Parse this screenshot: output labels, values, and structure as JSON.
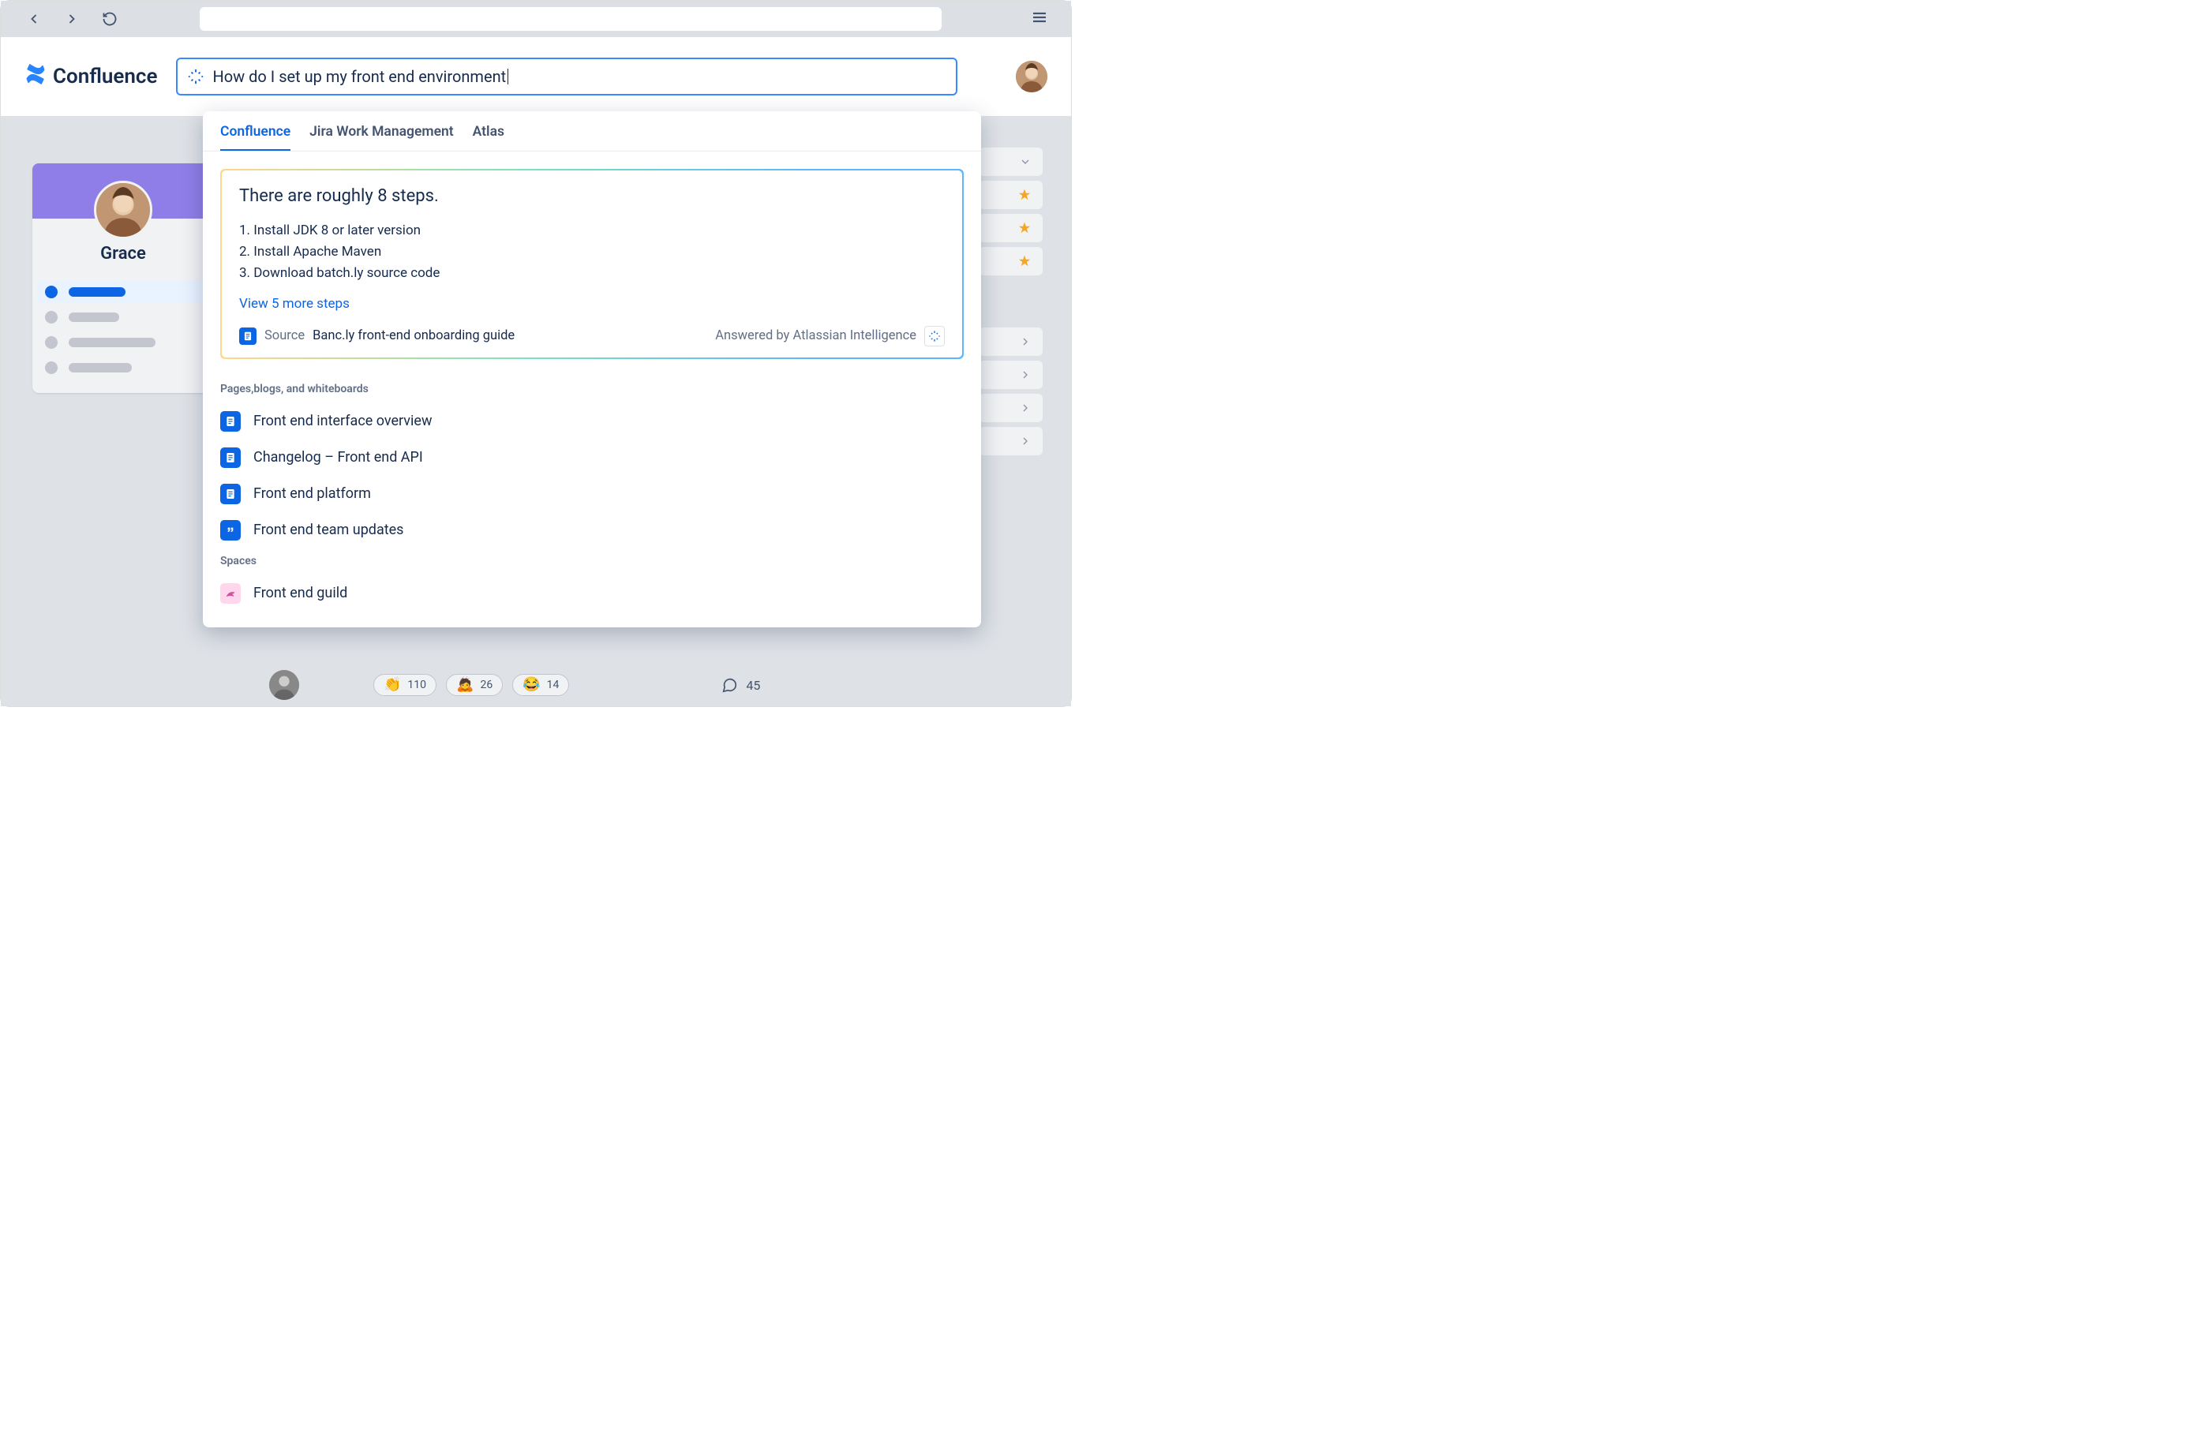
{
  "header": {
    "product": "Confluence"
  },
  "search": {
    "query": "How do I set up my front end environment"
  },
  "sidebar": {
    "user_name": "Grace"
  },
  "tabs": [
    {
      "label": "Confluence",
      "active": true
    },
    {
      "label": "Jira Work Management",
      "active": false
    },
    {
      "label": "Atlas",
      "active": false
    }
  ],
  "ai": {
    "heading": "There are roughly 8 steps.",
    "steps": [
      "1. Install JDK 8 or later version",
      "2. Install Apache Maven",
      "3. Download batch.ly  source code"
    ],
    "expand": "View 5 more steps",
    "source_label": "Source",
    "source_title": "Banc.ly front-end onboarding guide",
    "credit": "Answered by Atlassian Intelligence"
  },
  "sections": {
    "pages_label": "Pages,blogs, and whiteboards",
    "spaces_label": "Spaces"
  },
  "pages": [
    {
      "title": "Front end interface overview",
      "kind": "page"
    },
    {
      "title": "Changelog – Front end API",
      "kind": "page"
    },
    {
      "title": "Front end platform",
      "kind": "page"
    },
    {
      "title": "Front end team updates",
      "kind": "blog"
    }
  ],
  "spaces": [
    {
      "title": "Front end guild"
    }
  ],
  "reactions": [
    {
      "emoji": "👏",
      "count": "110"
    },
    {
      "emoji": "🙇",
      "count": "26"
    },
    {
      "emoji": "😂",
      "count": "14"
    }
  ],
  "comments": {
    "count": "45"
  }
}
